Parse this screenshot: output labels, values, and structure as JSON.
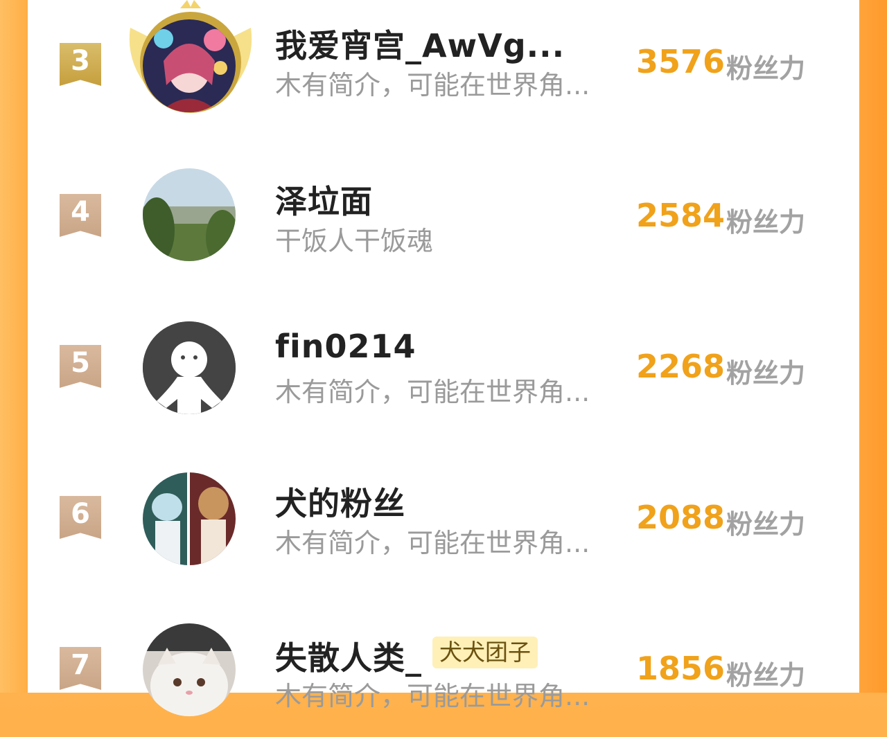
{
  "unit_label": "粉丝力",
  "ranking": [
    {
      "rank": "3",
      "name": "我爱宵宫_AwVg...",
      "bio": "木有简介，可能在世界角...",
      "score": "3576",
      "tier": "gold"
    },
    {
      "rank": "4",
      "name": "泽垃面",
      "bio": "干饭人干饭魂",
      "score": "2584",
      "tier": "tan"
    },
    {
      "rank": "5",
      "name": "fin0214",
      "bio": "木有简介，可能在世界角...",
      "score": "2268",
      "tier": "tan"
    },
    {
      "rank": "6",
      "name": "犬的粉丝",
      "bio": "木有简介，可能在世界角...",
      "score": "2088",
      "tier": "tan"
    },
    {
      "rank": "7",
      "name": "失散人类_",
      "tag": "犬犬团子",
      "bio": "木有简介，可能在世界角...",
      "score": "1856",
      "tier": "tan"
    }
  ],
  "colors": {
    "accent": "#f0a21b",
    "gold": "#c69f3d",
    "tan": "#c9a586"
  }
}
